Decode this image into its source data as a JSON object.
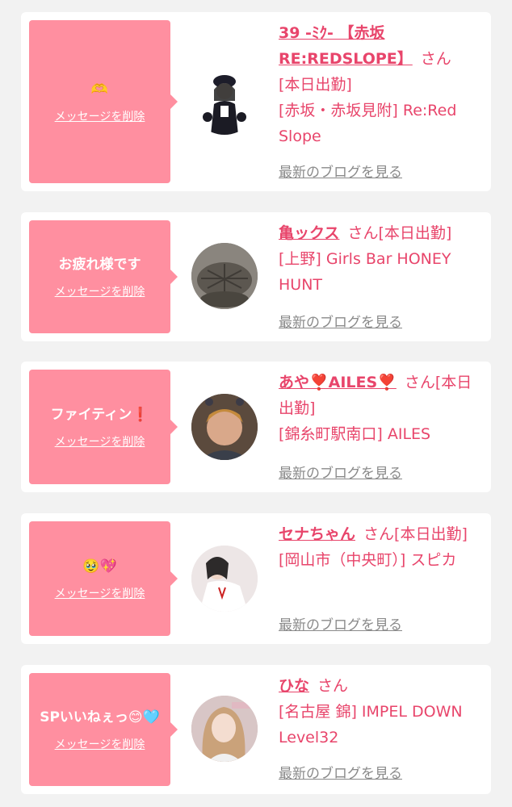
{
  "cards": [
    {
      "message": "🫶",
      "delete_label": "メッセージを削除",
      "name": "39 -ﾐｸ- 【赤坂 RE:REDSLOPE】",
      "suffix": "さん",
      "attendance": "[本日出勤]",
      "shop": "[赤坂・赤坂見附] Re:Red Slope",
      "blog_label": "最新のブログを見る"
    },
    {
      "message": "お疲れ様です",
      "delete_label": "メッセージを削除",
      "name": "亀ックス",
      "suffix": "さん",
      "attendance": "[本日出勤]",
      "shop": "[上野] Girls Bar HONEY HUNT",
      "blog_label": "最新のブログを見る"
    },
    {
      "message": "ファイティン❗",
      "delete_label": "メッセージを削除",
      "name": "あや❣️AILES❣️",
      "suffix": "さん",
      "attendance": "[本日出勤]",
      "shop": "[錦糸町駅南口] AILES",
      "blog_label": "最新のブログを見る"
    },
    {
      "message": "🥹💖",
      "delete_label": "メッセージを削除",
      "name": "セナちゃん",
      "suffix": "さん",
      "attendance": "[本日出勤]",
      "shop": "[岡山市（中央町）] スピカ",
      "blog_label": "最新のブログを見る"
    },
    {
      "message": "SPいいねぇっ😊🩵",
      "delete_label": "メッセージを削除",
      "name": "ひな",
      "suffix": "さん",
      "attendance": "",
      "shop": "[名古屋 錦] IMPEL DOWN Level32",
      "blog_label": "最新のブログを見る"
    }
  ]
}
